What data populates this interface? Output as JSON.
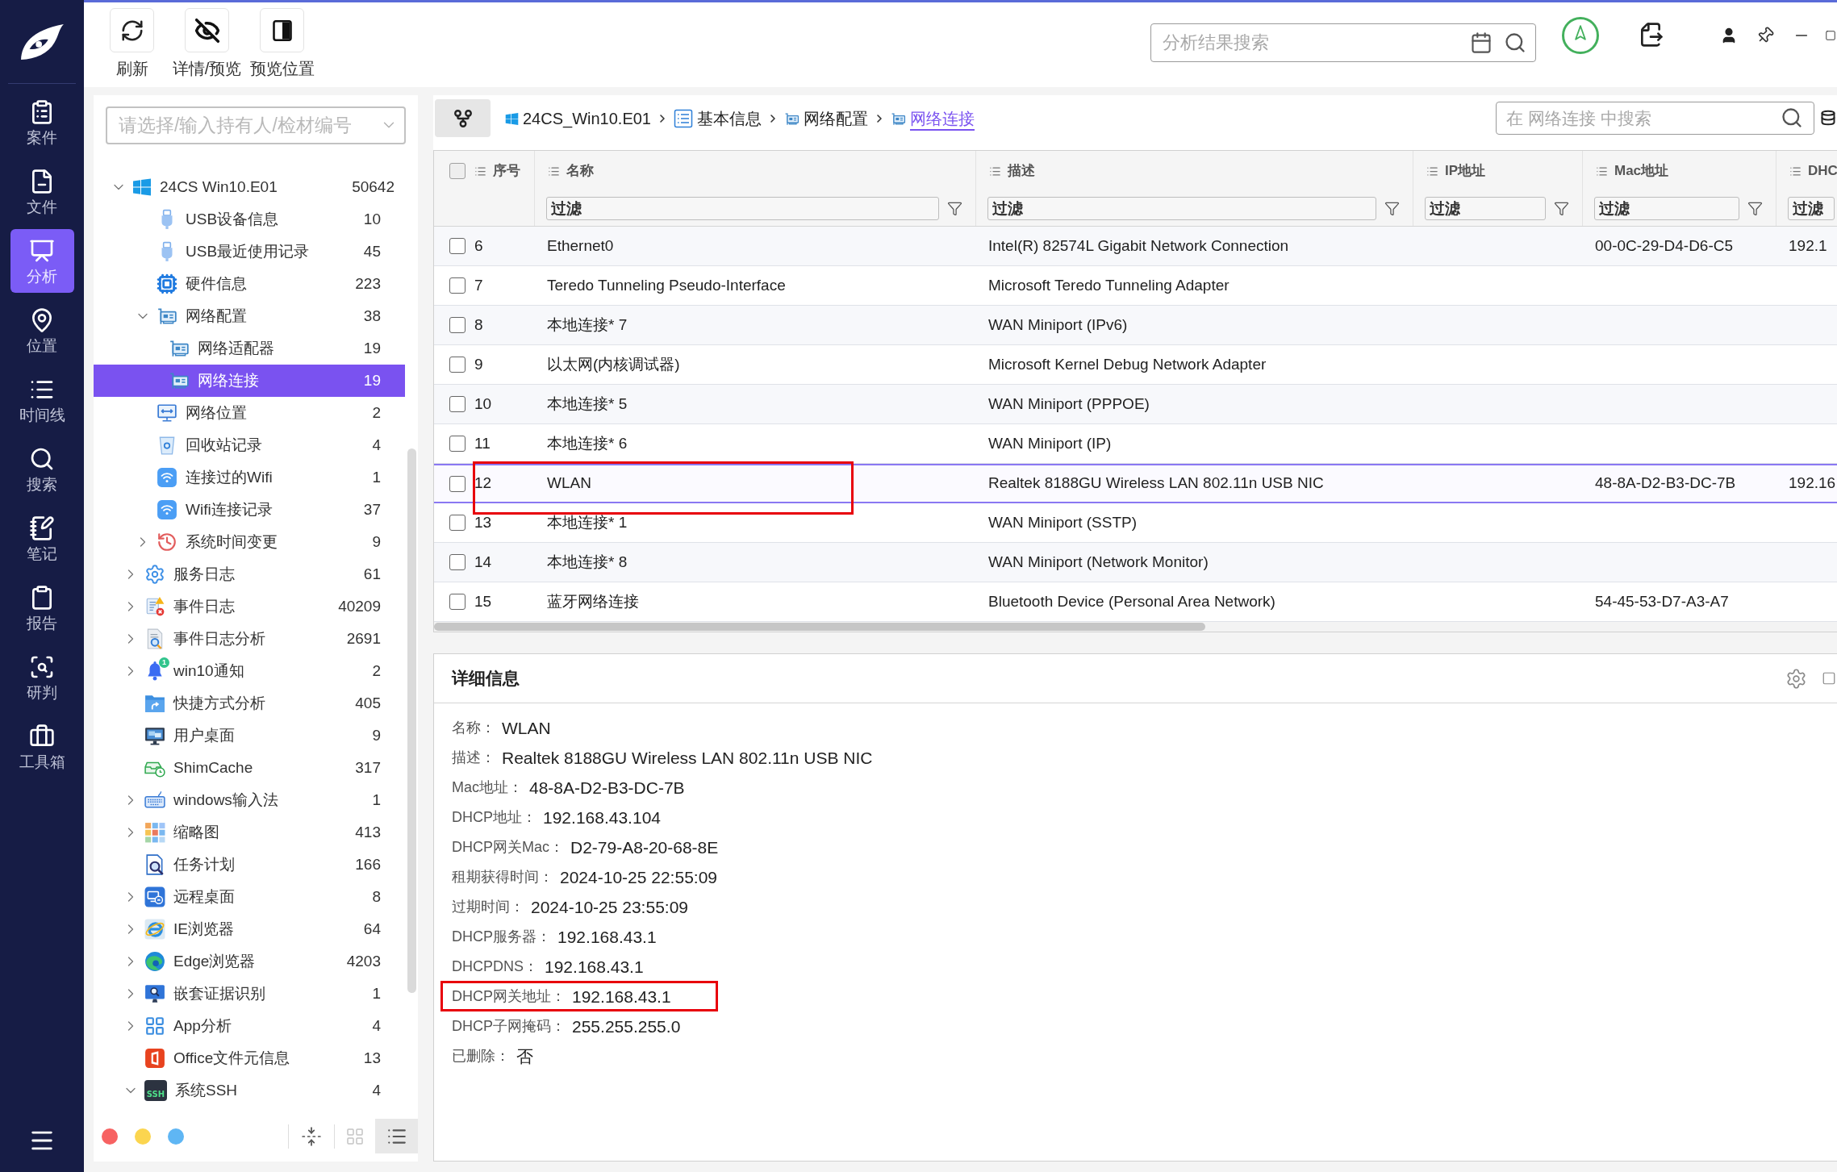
{
  "nav": {
    "items": [
      {
        "label": "案件",
        "selected": false
      },
      {
        "label": "文件",
        "selected": false
      },
      {
        "label": "分析",
        "selected": true
      },
      {
        "label": "位置",
        "selected": false
      },
      {
        "label": "时间线",
        "selected": false
      },
      {
        "label": "搜索",
        "selected": false
      },
      {
        "label": "笔记",
        "selected": false
      },
      {
        "label": "报告",
        "selected": false
      },
      {
        "label": "研判",
        "selected": false
      },
      {
        "label": "工具箱",
        "selected": false
      }
    ]
  },
  "toolbar": {
    "buttons": [
      {
        "label": "刷新"
      },
      {
        "label": "详情/预览"
      },
      {
        "label": "预览位置"
      }
    ]
  },
  "header_search": {
    "placeholder": "分析结果搜索"
  },
  "evidence_select": {
    "placeholder": "请选择/输入持有人/检材编号"
  },
  "tree": [
    {
      "label": "24CS Win10.E01",
      "count": "50642",
      "expanded": true,
      "selected": false,
      "children": [
        {
          "children": [
            {
              "label": "USB设备信息",
              "count": "10",
              "selected": false
            },
            {
              "label": "USB最近使用记录",
              "count": "45",
              "selected": false
            },
            {
              "label": "硬件信息",
              "count": "223",
              "selected": false
            },
            {
              "label": "网络配置",
              "count": "38",
              "expanded": true,
              "selected": false,
              "children": [
                {
                  "label": "网络适配器",
                  "count": "19",
                  "selected": false
                },
                {
                  "label": "网络连接",
                  "count": "19",
                  "selected": true
                }
              ]
            },
            {
              "label": "网络位置",
              "count": "2",
              "selected": false
            },
            {
              "label": "回收站记录",
              "count": "4",
              "selected": false
            },
            {
              "label": "连接过的Wifi",
              "count": "1",
              "selected": false
            },
            {
              "label": "Wifi连接记录",
              "count": "37",
              "selected": false
            },
            {
              "label": "系统时间变更",
              "count": "9",
              "expanded": false,
              "selected": false
            }
          ]
        },
        {
          "label": "服务日志",
          "count": "61",
          "expanded": false,
          "selected": false
        },
        {
          "label": "事件日志",
          "count": "40209",
          "expanded": false,
          "selected": false
        },
        {
          "label": "事件日志分析",
          "count": "2691",
          "expanded": false,
          "selected": false
        },
        {
          "label": "win10通知",
          "count": "2",
          "expanded": false,
          "selected": false,
          "badge": "1"
        },
        {
          "label": "快捷方式分析",
          "count": "405",
          "selected": false
        },
        {
          "label": "用户桌面",
          "count": "9",
          "selected": false
        },
        {
          "label": "ShimCache",
          "count": "317",
          "selected": false
        },
        {
          "label": "windows输入法",
          "count": "1",
          "expanded": false,
          "selected": false
        },
        {
          "label": "缩略图",
          "count": "413",
          "expanded": false,
          "selected": false
        },
        {
          "label": "任务计划",
          "count": "166",
          "selected": false
        },
        {
          "label": "远程桌面",
          "count": "8",
          "expanded": false,
          "selected": false
        },
        {
          "label": "IE浏览器",
          "count": "64",
          "expanded": false,
          "selected": false
        },
        {
          "label": "Edge浏览器",
          "count": "4203",
          "expanded": false,
          "selected": false
        },
        {
          "label": "嵌套证据识别",
          "count": "1",
          "expanded": false,
          "selected": false
        },
        {
          "label": "App分析",
          "count": "4",
          "expanded": false,
          "selected": false
        },
        {
          "label": "Office文件元信息",
          "count": "13",
          "selected": false
        },
        {
          "label": "系统SSH",
          "count": "4",
          "expanded": true,
          "selected": false,
          "icon_label": "SSH"
        }
      ]
    }
  ],
  "tree_footer": {
    "color_filters": [
      {
        "color": "#f76262"
      },
      {
        "color": "#fbd54f"
      },
      {
        "color": "#5fb6f4"
      }
    ],
    "view_modes": [
      {
        "selected": false
      },
      {
        "selected": true
      }
    ]
  },
  "breadcrumb": [
    {
      "label": "24CS_Win10.E01",
      "selected": false
    },
    {
      "label": "基本信息",
      "selected": false
    },
    {
      "label": "网络配置",
      "selected": false
    },
    {
      "label": "网络连接",
      "selected": true
    }
  ],
  "table_search": {
    "placeholder": "在 网络连接 中搜索"
  },
  "table": {
    "header_checkbox": {
      "checked": false
    },
    "columns": [
      {
        "label": "序号"
      },
      {
        "label": "名称",
        "filter_placeholder": "过滤"
      },
      {
        "label": "描述",
        "filter_placeholder": "过滤"
      },
      {
        "label": "IP地址",
        "filter_placeholder": "过滤"
      },
      {
        "label": "Mac地址",
        "filter_placeholder": "过滤"
      },
      {
        "label": "DHC",
        "filter_placeholder": "过滤"
      }
    ],
    "rows": [
      {
        "index": "6",
        "name": "Ethernet0",
        "description": "Intel(R) 82574L Gigabit Network Connection",
        "mac": "00-0C-29-D4-D6-C5",
        "dhcp": "192.1",
        "checked": false,
        "selected": false,
        "highlighted": false
      },
      {
        "index": "7",
        "name": "Teredo Tunneling Pseudo-Interface",
        "description": "Microsoft Teredo Tunneling Adapter",
        "checked": false,
        "selected": false,
        "highlighted": false
      },
      {
        "index": "8",
        "name": "本地连接* 7",
        "description": "WAN Miniport (IPv6)",
        "checked": false,
        "selected": false,
        "highlighted": false
      },
      {
        "index": "9",
        "name": "以太网(内核调试器)",
        "description": "Microsoft Kernel Debug Network Adapter",
        "checked": false,
        "selected": false,
        "highlighted": false
      },
      {
        "index": "10",
        "name": "本地连接* 5",
        "description": "WAN Miniport (PPPOE)",
        "checked": false,
        "selected": false,
        "highlighted": false
      },
      {
        "index": "11",
        "name": "本地连接* 6",
        "description": "WAN Miniport (IP)",
        "checked": false,
        "selected": false,
        "highlighted": false
      },
      {
        "index": "12",
        "name": "WLAN",
        "description": "Realtek 8188GU Wireless LAN 802.11n USB NIC",
        "mac": "48-8A-D2-B3-DC-7B",
        "dhcp": "192.16",
        "checked": false,
        "selected": true,
        "highlighted": true
      },
      {
        "index": "13",
        "name": "本地连接* 1",
        "description": "WAN Miniport (SSTP)",
        "checked": false,
        "selected": false,
        "highlighted": false
      },
      {
        "index": "14",
        "name": "本地连接* 8",
        "description": "WAN Miniport (Network Monitor)",
        "checked": false,
        "selected": false,
        "highlighted": false
      },
      {
        "index": "15",
        "name": "蓝牙网络连接",
        "description": "Bluetooth Device (Personal Area Network)",
        "mac": "54-45-53-D7-A3-A7",
        "checked": false,
        "selected": false,
        "highlighted": false
      }
    ]
  },
  "details": {
    "title": "详细信息",
    "fields": [
      {
        "label": "名称：",
        "value": "WLAN",
        "highlighted": false
      },
      {
        "label": "描述：",
        "value": "Realtek 8188GU Wireless LAN 802.11n USB NIC",
        "highlighted": false
      },
      {
        "label": "Mac地址：",
        "value": "48-8A-D2-B3-DC-7B",
        "highlighted": false
      },
      {
        "label": "DHCP地址：",
        "value": "192.168.43.104",
        "highlighted": false
      },
      {
        "label": "DHCP网关Mac：",
        "value": "D2-79-A8-20-68-8E",
        "highlighted": false
      },
      {
        "label": "租期获得时间：",
        "value": "2024-10-25 22:55:09",
        "highlighted": false
      },
      {
        "label": "过期时间：",
        "value": "2024-10-25 23:55:09",
        "highlighted": false
      },
      {
        "label": "DHCP服务器：",
        "value": "192.168.43.1",
        "highlighted": false
      },
      {
        "label": "DHCPDNS：",
        "value": "192.168.43.1",
        "highlighted": false
      },
      {
        "label": "DHCP网关地址：",
        "value": "192.168.43.1",
        "highlighted": true
      },
      {
        "label": "DHCP子网掩码：",
        "value": "255.255.255.0",
        "highlighted": false
      },
      {
        "label": "已删除：",
        "value": "否",
        "highlighted": false
      }
    ]
  }
}
